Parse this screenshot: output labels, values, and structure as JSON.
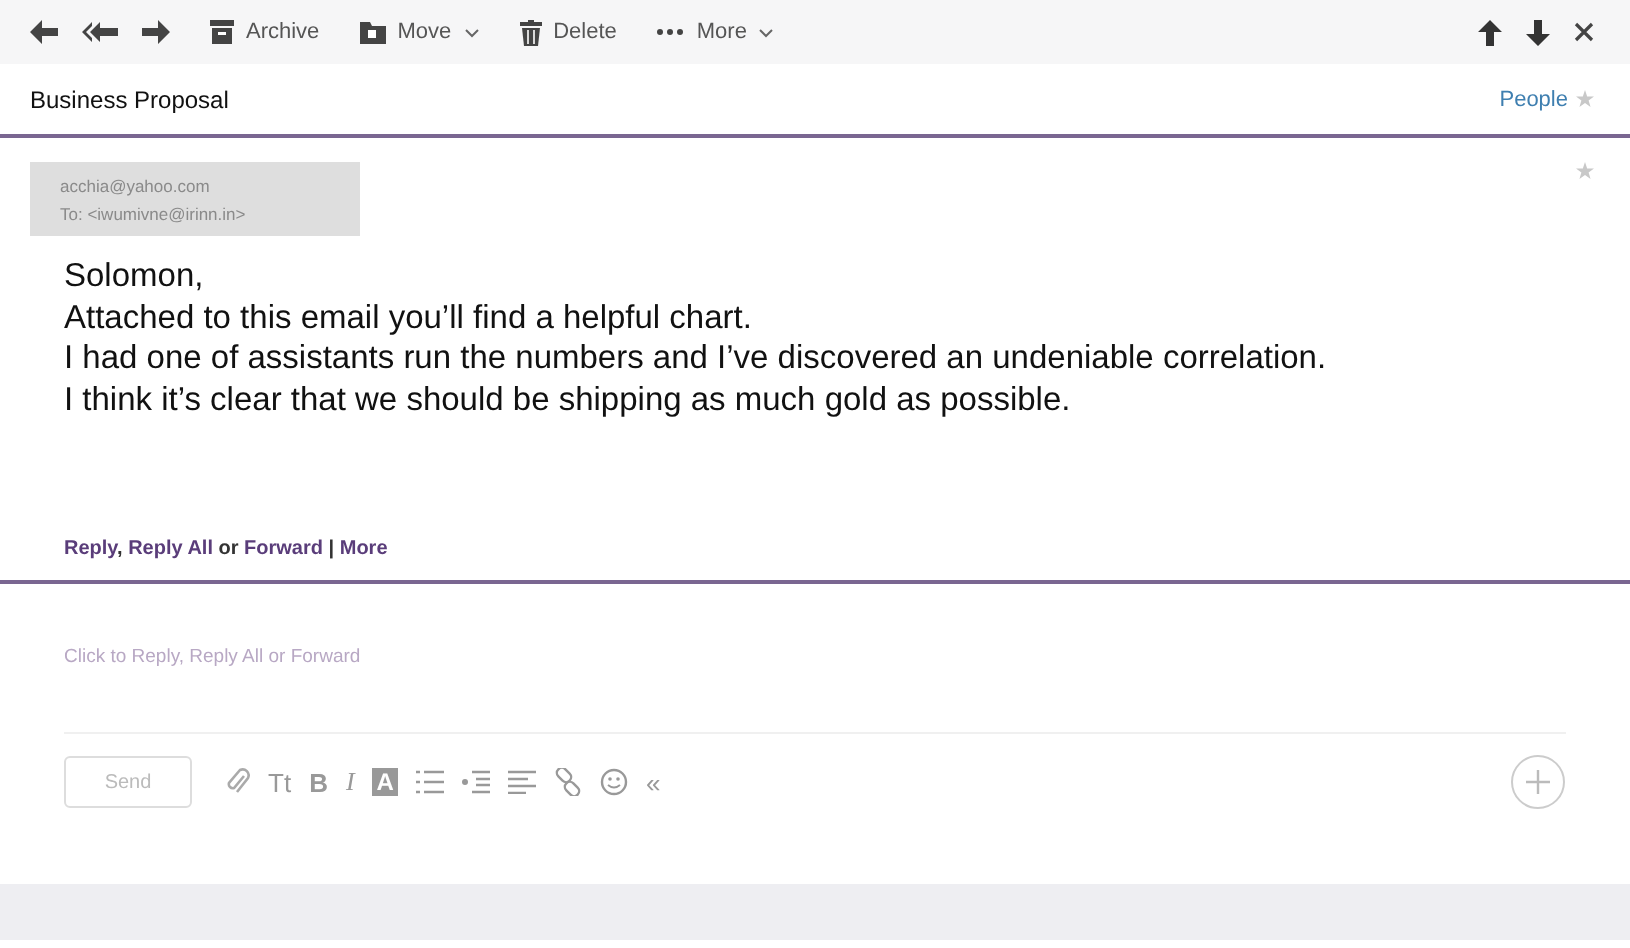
{
  "toolbar": {
    "nav": [
      {
        "kind": "reply"
      },
      {
        "kind": "reply_all"
      },
      {
        "kind": "forward"
      }
    ],
    "actions": [
      {
        "kind": "archive",
        "label": "Archive",
        "dropdown": false
      },
      {
        "kind": "move",
        "label": "Move",
        "dropdown": true
      },
      {
        "kind": "delete",
        "label": "Delete",
        "dropdown": false
      },
      {
        "kind": "more",
        "label": "More",
        "dropdown": true
      }
    ]
  },
  "subject": "Business Proposal",
  "people_link": "People",
  "sender": {
    "from": "acchia@yahoo.com",
    "to": "To: <iwumivne@irinn.in>"
  },
  "body": [
    "Solomon,",
    "Attached to this email you’ll find a helpful chart.",
    "I had one of assistants run the numbers and I’ve discovered an undeniable correlation.",
    "I think it’s clear that we should be shipping as much gold as possible."
  ],
  "reply_links": [
    {
      "kind": "link",
      "text": "Reply"
    },
    {
      "kind": "plain",
      "text": ", "
    },
    {
      "kind": "link",
      "text": "Reply All"
    },
    {
      "kind": "plain",
      "text": " or "
    },
    {
      "kind": "link",
      "text": "Forward"
    },
    {
      "kind": "plain",
      "text": " | "
    },
    {
      "kind": "link",
      "text": "More"
    }
  ],
  "compose": {
    "placeholder": "Click to Reply, Reply All or Forward",
    "send": "Send",
    "tools": [
      {
        "kind": "attach"
      },
      {
        "kind": "text",
        "label": "Tt"
      },
      {
        "kind": "bold",
        "label": "B"
      },
      {
        "kind": "italic",
        "label": "I"
      },
      {
        "kind": "boxed",
        "label": "A"
      },
      {
        "kind": "list"
      },
      {
        "kind": "indent"
      },
      {
        "kind": "align"
      },
      {
        "kind": "link"
      },
      {
        "kind": "emoji"
      },
      {
        "kind": "text",
        "label": "«"
      }
    ]
  }
}
